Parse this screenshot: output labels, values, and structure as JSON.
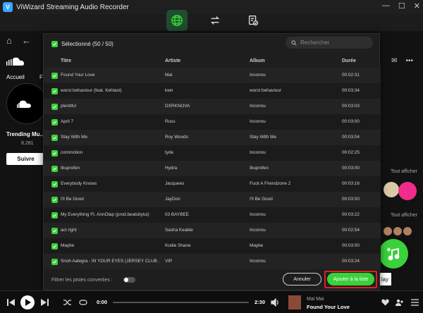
{
  "window": {
    "title": "ViWizard Streaming Audio Recorder",
    "logo_glyph": "V",
    "controls": [
      "—",
      "☐",
      "✕"
    ]
  },
  "top_tabs": [
    {
      "name": "globe-icon",
      "active": true
    },
    {
      "name": "convert-icon",
      "active": false
    },
    {
      "name": "converted-list-icon",
      "active": false
    }
  ],
  "background_page": {
    "tabs": [
      "Accueil",
      "Fi"
    ],
    "trending_title": "Trending Mu...",
    "followers": "8.281",
    "follow_button": "Suivre",
    "see_all_1": "Tout afficher",
    "see_all_2": "Tout afficher",
    "play_label": "lay"
  },
  "dialog": {
    "selected_label": "Sélectionné (50 / 50)",
    "search_placeholder": "Rechercher",
    "columns": {
      "title": "Titre",
      "artist": "Artiste",
      "album": "Album",
      "duration": "Durée"
    },
    "tracks": [
      {
        "title": "Found Your Love",
        "artist": "Mai",
        "album": "Inconnu",
        "duration": "00:02:31"
      },
      {
        "title": "worst behaviour (feat. Kehlani)",
        "artist": "kwn",
        "album": "worst behaviour",
        "duration": "00:03:34"
      },
      {
        "title": "plentiful",
        "artist": "DXRKNOVA",
        "album": "Inconnu",
        "duration": "00:03:03"
      },
      {
        "title": "April 7",
        "artist": "Russ",
        "album": "Inconnu",
        "duration": "00:03:00"
      },
      {
        "title": "Stay With Me",
        "artist": "Roy Woods",
        "album": "Stay With Me",
        "duration": "00:03:04"
      },
      {
        "title": "commotion",
        "artist": "tyde",
        "album": "Inconnu",
        "duration": "00:02:25"
      },
      {
        "title": "Ibuprofen",
        "artist": "Hydra",
        "album": "Ibuprofen",
        "duration": "00:03:00"
      },
      {
        "title": "Everybody Knows",
        "artist": "Jacquees",
        "album": "Fuck A Friendzone 2",
        "duration": "00:03:16"
      },
      {
        "title": "I'll Be Good",
        "artist": "JayDon",
        "album": "I'll Be Good",
        "duration": "00:03:00"
      },
      {
        "title": "My Everything Ft. AnnOlap (prod.beatsbytui)",
        "artist": "03 BAYBEE",
        "album": "Inconnu",
        "duration": "00:03:22"
      },
      {
        "title": "act right",
        "artist": "Sasha Keable",
        "album": "Inconnu",
        "duration": "00:02:54"
      },
      {
        "title": "Maybe",
        "artist": "Kodie Shane",
        "album": "Maybe",
        "duration": "00:03:00"
      },
      {
        "title": "Snoh Aalegra - IN YOUR EYES (JERSEY CLUB ...",
        "artist": "VIP",
        "album": "Inconnu",
        "duration": "00:03:24"
      }
    ],
    "filter_label": "Filtrer les pistes converties :",
    "filter_on": false,
    "cancel_label": "Annuler",
    "add_label": "Ajouter à la liste"
  },
  "player": {
    "elapsed": "0:00",
    "total": "2:30",
    "progress": 0,
    "artist": "Mai Mai",
    "track": "Found Your Love"
  },
  "colors": {
    "accent": "#3ad13a",
    "highlight": "#e02020",
    "dialog_bg": "#1e1e1e"
  }
}
